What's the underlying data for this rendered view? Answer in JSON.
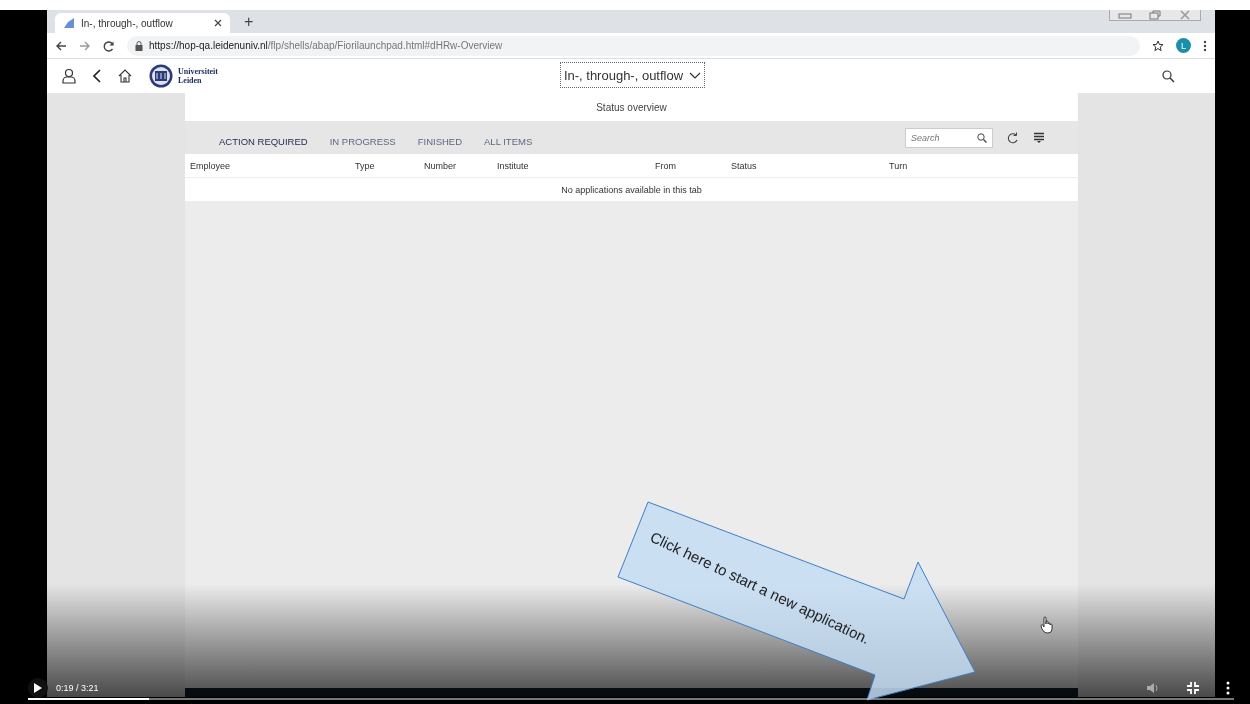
{
  "browser": {
    "tab_title": "In-, through-, outflow",
    "new_tab": "+",
    "url": {
      "origin": "https://hop-qa.leidenuniv.nl",
      "path": "/flp/shells/abap/Fiorilaunchpad.html#dHRw-Overview"
    },
    "profile_initial": "L"
  },
  "app_header": {
    "logo_text": [
      "Universiteit",
      "Leiden"
    ],
    "title": "In-, through-, outflow"
  },
  "panel": {
    "title": "Status overview",
    "tabs": [
      {
        "label": "ACTION REQUIRED",
        "selected": true
      },
      {
        "label": "IN PROGRESS",
        "selected": false
      },
      {
        "label": "FINISHED",
        "selected": false
      },
      {
        "label": "ALL ITEMS",
        "selected": false
      }
    ],
    "search": {
      "placeholder": "Search"
    },
    "columns": [
      "Employee",
      "Type",
      "Number",
      "Institute",
      "From",
      "Status",
      "Turn"
    ],
    "empty_message": "No applications available in this tab"
  },
  "callout": {
    "text": "Click here to start a new application."
  },
  "player": {
    "time": "0:19 / 3:21",
    "progress": {
      "level": 0.1
    }
  }
}
